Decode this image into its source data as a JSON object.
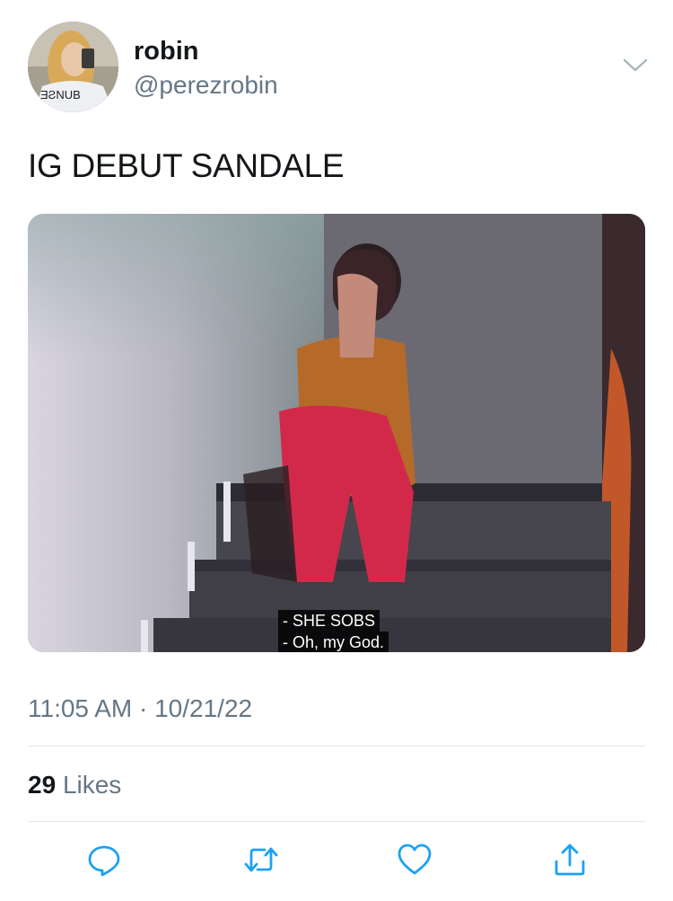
{
  "tweet": {
    "author": {
      "name": "robin",
      "handle": "@perezrobin",
      "avatar_icon": "profile-photo"
    },
    "text": "IG DEBUT SANDALE",
    "media": {
      "subtitle_line1": "- SHE SOBS",
      "subtitle_line2": "- Oh, my God."
    },
    "timestamp": "11:05 AM · 10/21/22",
    "likes": {
      "count": "29",
      "label": "Likes"
    },
    "actions": [
      {
        "icon": "reply-icon"
      },
      {
        "icon": "retweet-icon"
      },
      {
        "icon": "like-icon"
      },
      {
        "icon": "share-icon"
      }
    ],
    "colors": {
      "secondary_text": "#657786",
      "icon": "#1da1f2",
      "divider": "#e1e8ed"
    }
  }
}
